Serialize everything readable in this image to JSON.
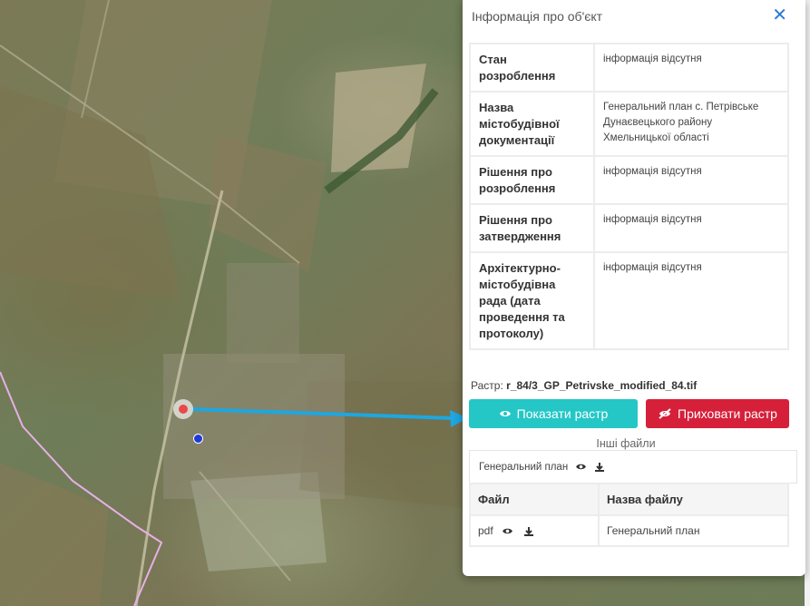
{
  "panel": {
    "title": "Інформація про об'єкт",
    "close_icon": "close-icon"
  },
  "properties": [
    {
      "label": "Стан розроблення",
      "value": "інформація відсутня"
    },
    {
      "label": "Назва містобудівної документації",
      "value": "Генеральний план с. Петрівське Дунаєвецького району Хмельницької області"
    },
    {
      "label": "Рішення про розроблення",
      "value": "інформація відсутня"
    },
    {
      "label": "Рішення про затвердження",
      "value": "інформація відсутня"
    },
    {
      "label": "Архітектурно-містобудівна рада (дата проведення та протоколу)",
      "value": "інформація відсутня"
    }
  ],
  "raster": {
    "prefix": "Растр:",
    "file": "r_84/3_GP_Petrivske_modified_84.tif"
  },
  "buttons": {
    "show_raster": "Показати растр",
    "hide_raster": "Приховати растр",
    "show_color": "#25c6c6",
    "hide_color": "#d6203a"
  },
  "other_files": {
    "title": "Інші файли",
    "general_plan_label": "Генеральний план"
  },
  "files_table": {
    "headers": [
      "Файл",
      "Назва файлу"
    ],
    "rows": [
      {
        "type": "pdf",
        "name": "Генеральний план"
      }
    ]
  },
  "map": {
    "marker_color": "#e84a4a",
    "arrow_color": "#1ea7e0"
  }
}
